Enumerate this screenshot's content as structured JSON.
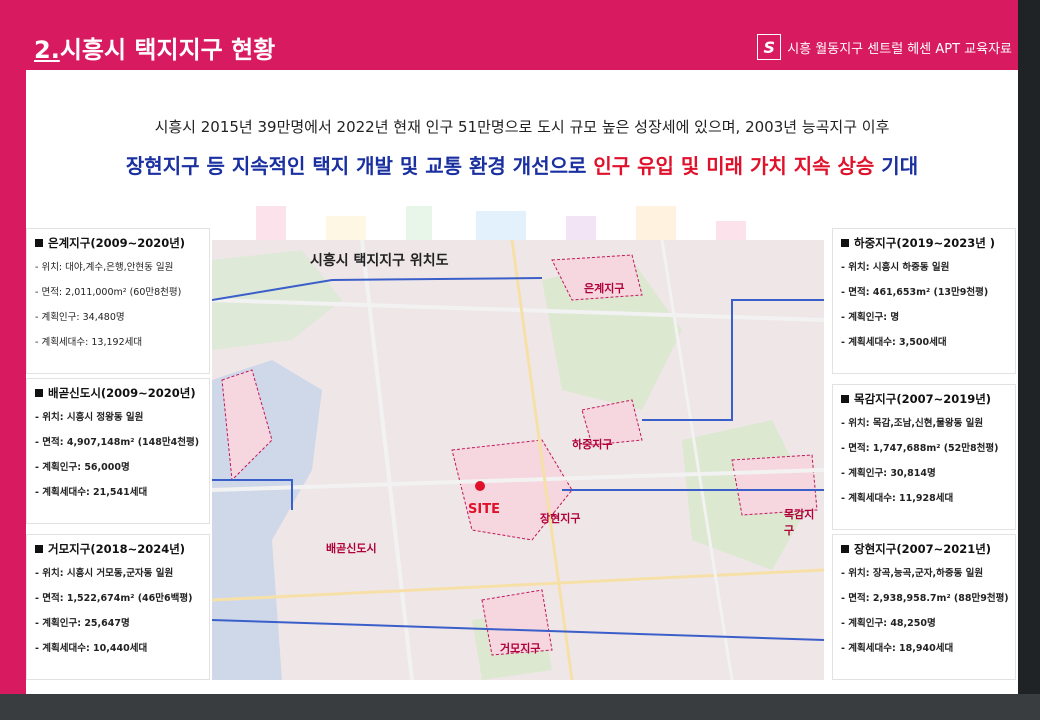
{
  "header": {
    "title_num": "2.",
    "title_text": "시흥시 택지지구 현황",
    "right_text": "시흥 월동지구 센트럴 헤센 APT 교육자료",
    "logo_glyph": "S"
  },
  "headline": {
    "line1": "시흥시 2015년 39만명에서 2022년 현재 인구 51만명으로 도시 규모 높은 성장세에 있으며, 2003년 능곡지구 이후",
    "line2_blue": "장현지구 등 지속적인 택지 개발 및 교통 환경 개선으로 ",
    "line2_red": "인구 유입 및 미래 가치 지속 상승",
    "line2_tail": " 기대"
  },
  "map": {
    "title": "시흥시 택지지구 위치도",
    "labels": {
      "eungye": "은계지구",
      "hajung": "하중지구",
      "janghyeon": "장현지구",
      "mokgam": "목감지구",
      "baegot": "배곧신도시",
      "geomo": "거모지구",
      "site": "SITE"
    }
  },
  "panels": {
    "eungye": {
      "title": "은계지구(2009~2020년)",
      "rows": [
        "- 위치: 대야,계수,은행,안현동 일원",
        "- 면적: 2,011,000m² (60만8천평)",
        "- 계획인구: 34,480명",
        "- 계획세대수: 13,192세대"
      ]
    },
    "baegot": {
      "title": "배곧신도시(2009~2020년)",
      "rows": [
        "- 위치: 시흥시 정왕동 일원",
        "- 면적: 4,907,148m² (148만4천평)",
        "- 계획인구: 56,000명",
        "- 계획세대수: 21,541세대"
      ]
    },
    "geomo": {
      "title": "거모지구(2018~2024년)",
      "rows": [
        "- 위치: 시흥시 거모동,군자동 일원",
        "- 면적: 1,522,674m² (46만6백평)",
        "- 계획인구: 25,647명",
        "- 계획세대수: 10,440세대"
      ]
    },
    "hajung": {
      "title": "하중지구(2019~2023년 )",
      "rows": [
        "- 위치: 시흥시 하중동 일원",
        "- 면적: 461,653m² (13만9천평)",
        "- 계획인구: 명",
        "- 계획세대수: 3,500세대"
      ]
    },
    "mokgam": {
      "title": "목감지구(2007~2019년)",
      "rows": [
        "- 위치: 목감,조남,신현,물왕동 일원",
        "- 면적: 1,747,688m² (52만8천평)",
        "- 계획인구: 30,814명",
        "- 계획세대수: 11,928세대"
      ]
    },
    "janghyeon": {
      "title": "장현지구(2007~2021년)",
      "rows": [
        "- 위치: 장곡,능곡,군자,하중동 일원",
        "- 면적: 2,938,958.7m² (88만9천평)",
        "- 계획인구: 48,250명",
        "- 계획세대수: 18,940세대"
      ]
    }
  },
  "colors": {
    "brand": "#d81b60",
    "headline_blue": "#1a2fa0",
    "headline_red": "#e0112b",
    "connector": "#3b5fc9"
  }
}
